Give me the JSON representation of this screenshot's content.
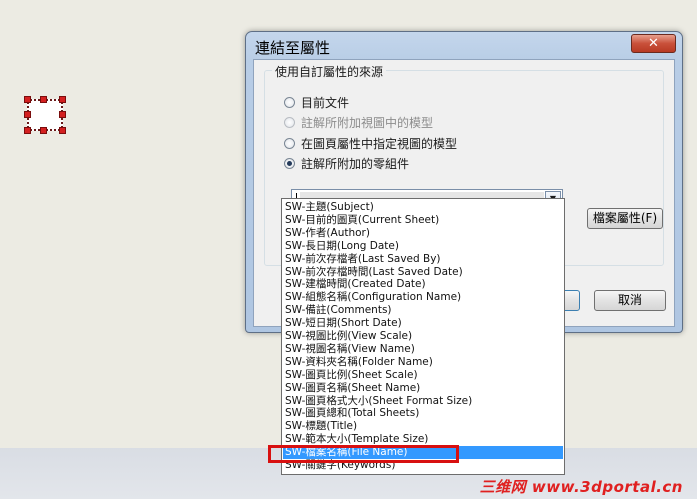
{
  "dialog": {
    "title": "連結至屬性",
    "close_label": "✕",
    "group_title": "使用自訂屬性的來源",
    "options": [
      {
        "label": "目前文件",
        "checked": false,
        "disabled": false
      },
      {
        "label": "註解所附加視圖中的模型",
        "checked": false,
        "disabled": true
      },
      {
        "label": "在圖頁屬性中指定視圖的模型",
        "checked": false,
        "disabled": false
      },
      {
        "label": "註解所附加的零組件",
        "checked": true,
        "disabled": false
      }
    ],
    "combo_value": "",
    "file_props_button": "檔案屬性(F)",
    "cancel_button": "取消"
  },
  "dropdown": {
    "items": [
      "SW-主題(Subject)",
      "SW-目前的圖頁(Current Sheet)",
      "SW-作者(Author)",
      "SW-長日期(Long Date)",
      "SW-前次存檔者(Last Saved By)",
      "SW-前次存檔時間(Last Saved Date)",
      "SW-建檔時間(Created Date)",
      "SW-組態名稱(Configuration Name)",
      "SW-備註(Comments)",
      "SW-短日期(Short Date)",
      "SW-視圖比例(View Scale)",
      "SW-視圖名稱(View Name)",
      "SW-資料夾名稱(Folder Name)",
      "SW-圖頁比例(Sheet Scale)",
      "SW-圖頁名稱(Sheet Name)",
      "SW-圖頁格式大小(Sheet Format Size)",
      "SW-圖頁總和(Total Sheets)",
      "SW-標題(Title)",
      "SW-範本大小(Template Size)",
      "SW-檔案名稱(File Name)",
      "SW-關鍵字(Keywords)"
    ],
    "selected_index": 19
  },
  "watermark": "三维网 www.3dportal.cn",
  "colors": {
    "selection": "#3399FF",
    "highlight_box": "#D81010",
    "watermark": "#E02020"
  }
}
